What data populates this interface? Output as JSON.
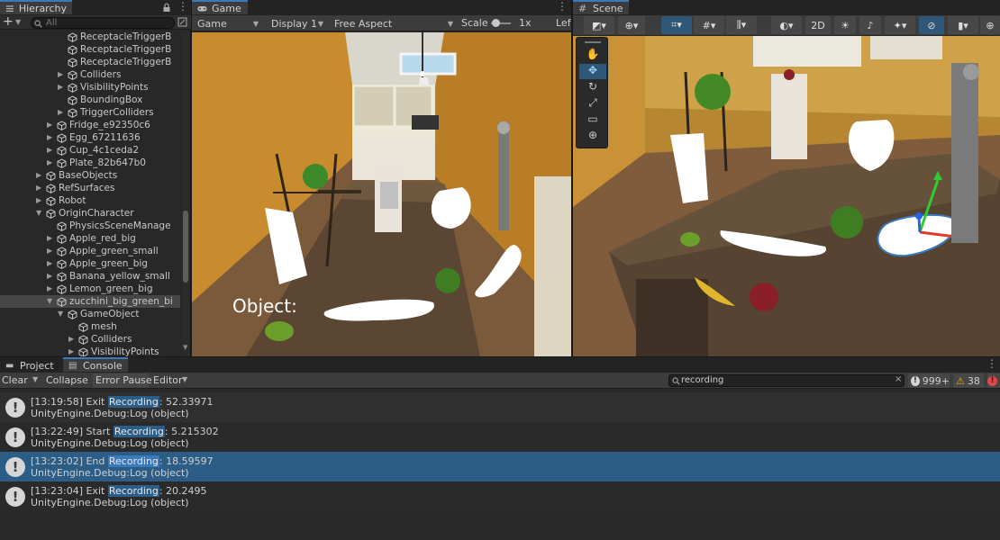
{
  "hierarchy": {
    "title": "Hierarchy",
    "search_placeholder": "All",
    "items": [
      {
        "label": "ReceptacleTriggerB",
        "indent": 5,
        "arrow": false
      },
      {
        "label": "ReceptacleTriggerB",
        "indent": 5,
        "arrow": false
      },
      {
        "label": "ReceptacleTriggerB",
        "indent": 5,
        "arrow": false
      },
      {
        "label": "Colliders",
        "indent": 5,
        "arrow": true
      },
      {
        "label": "VisibilityPoints",
        "indent": 5,
        "arrow": true
      },
      {
        "label": "BoundingBox",
        "indent": 5,
        "arrow": false
      },
      {
        "label": "TriggerColliders",
        "indent": 5,
        "arrow": true
      },
      {
        "label": "Fridge_e92350c6",
        "indent": 4,
        "arrow": true
      },
      {
        "label": "Egg_67211636",
        "indent": 4,
        "arrow": true
      },
      {
        "label": "Cup_4c1ceda2",
        "indent": 4,
        "arrow": true
      },
      {
        "label": "Plate_82b647b0",
        "indent": 4,
        "arrow": true
      },
      {
        "label": "BaseObjects",
        "indent": 3,
        "arrow": true
      },
      {
        "label": "RefSurfaces",
        "indent": 3,
        "arrow": true
      },
      {
        "label": "Robot",
        "indent": 3,
        "arrow": true
      },
      {
        "label": "OriginCharacter",
        "indent": 3,
        "arrow": true,
        "open": true
      },
      {
        "label": "PhysicsSceneManage",
        "indent": 4,
        "arrow": false
      },
      {
        "label": "Apple_red_big",
        "indent": 4,
        "arrow": true
      },
      {
        "label": "Apple_green_small",
        "indent": 4,
        "arrow": true
      },
      {
        "label": "Apple_green_big",
        "indent": 4,
        "arrow": true
      },
      {
        "label": "Banana_yellow_small",
        "indent": 4,
        "arrow": true
      },
      {
        "label": "Lemon_green_big",
        "indent": 4,
        "arrow": true
      },
      {
        "label": "zucchini_big_green_bi",
        "indent": 4,
        "arrow": true,
        "open": true,
        "selected": true
      },
      {
        "label": "GameObject",
        "indent": 5,
        "arrow": true,
        "open": true
      },
      {
        "label": "mesh",
        "indent": 6,
        "arrow": false
      },
      {
        "label": "Colliders",
        "indent": 6,
        "arrow": true
      },
      {
        "label": "VisibilityPoints",
        "indent": 6,
        "arrow": true
      }
    ]
  },
  "game": {
    "title": "Game",
    "display_mode": "Game",
    "display": "Display 1",
    "aspect": "Free Aspect",
    "scale_label": "Scale",
    "scale_value": "1x",
    "extra": "Lef",
    "object_label": "Object:"
  },
  "scene": {
    "title": "Scene",
    "btn_2d": "2D"
  },
  "bottom": {
    "tab_project": "Project",
    "tab_console": "Console",
    "clear": "Clear",
    "collapse": "Collapse",
    "error_pause": "Error Pause",
    "editor": "Editor",
    "search_value": "recording",
    "count_info": "999+",
    "count_warn": "38",
    "logs": [
      {
        "pre": "[13:19:58] Exit ",
        "hl": "Recording",
        "post": ": 52.33971",
        "line2": "UnityEngine.Debug:Log (object)",
        "selected": false
      },
      {
        "pre": "[13:22:49] Start ",
        "hl": "Recording",
        "post": ": 5.215302",
        "line2": "UnityEngine.Debug:Log (object)",
        "selected": false
      },
      {
        "pre": "[13:23:02] End ",
        "hl": "Recording",
        "post": ": 18.59597",
        "line2": "UnityEngine.Debug:Log (object)",
        "selected": true
      },
      {
        "pre": "[13:23:04] Exit ",
        "hl": "Recording",
        "post": ": 20.2495",
        "line2": "UnityEngine.Debug:Log (object)",
        "selected": false
      }
    ]
  },
  "colors": {
    "selection": "#2c5d87",
    "accent": "#3a79bb",
    "warn": "#f0b400"
  }
}
